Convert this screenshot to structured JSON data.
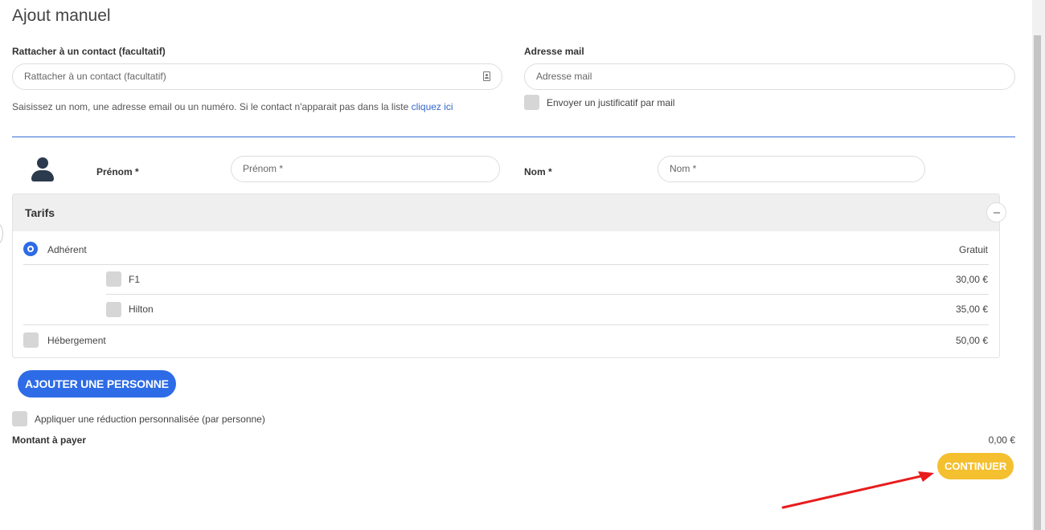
{
  "page_title": "Ajout manuel",
  "contact": {
    "label": "Rattacher à un contact (facultatif)",
    "placeholder": "Rattacher à un contact (facultatif)",
    "help_text": "Saisissez un nom, une adresse email ou un numéro. Si le contact n'apparait pas dans la liste ",
    "help_link": "cliquez ici"
  },
  "email": {
    "label": "Adresse mail",
    "placeholder": "Adresse mail",
    "send_receipt_label": "Envoyer un justificatif par mail"
  },
  "person": {
    "firstname_label": "Prénom *",
    "firstname_placeholder": "Prénom *",
    "lastname_label": "Nom *",
    "lastname_placeholder": "Nom *"
  },
  "tarifs": {
    "title": "Tarifs",
    "rows": [
      {
        "label": "Adhérent",
        "price": "Gratuit"
      },
      {
        "label": "F1",
        "price": "30,00 €"
      },
      {
        "label": "Hilton",
        "price": "35,00 €"
      },
      {
        "label": "Hébergement",
        "price": "50,00 €"
      }
    ]
  },
  "add_person_label": "AJOUTER UNE PERSONNE",
  "discount_label": "Appliquer une réduction personnalisée (par personne)",
  "amount": {
    "label": "Montant à payer",
    "value": "0,00 €"
  },
  "continue_label": "CONTINUER",
  "colors": {
    "primary": "#2e6be6",
    "accent": "#f4c030",
    "arrow": "#e81c1c"
  }
}
